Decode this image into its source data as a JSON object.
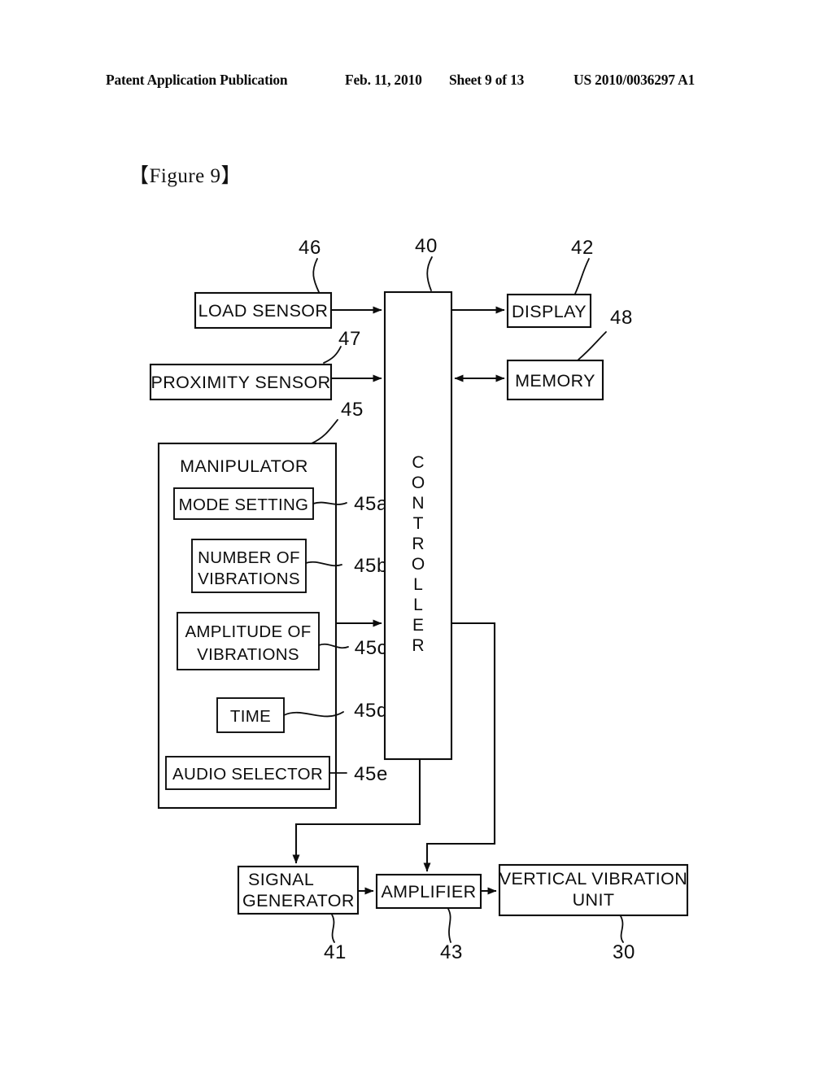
{
  "header": {
    "publication": "Patent Application Publication",
    "date": "Feb. 11, 2010",
    "sheet": "Sheet 9 of 13",
    "patent_number": "US 2010/0036297 A1"
  },
  "figure": {
    "label": "【Figure 9】"
  },
  "diagram": {
    "blocks": {
      "load_sensor": "LOAD SENSOR",
      "proximity_sensor": "PROXIMITY SENSOR",
      "manipulator": "MANIPULATOR",
      "mode_setting": "MODE SETTING",
      "number_of_vibrations_l1": "NUMBER OF",
      "number_of_vibrations_l2": "VIBRATIONS",
      "amplitude_of_vibrations_l1": "AMPLITUDE OF",
      "amplitude_of_vibrations_l2": "VIBRATIONS",
      "time": "TIME",
      "audio_selector": "AUDIO SELECTOR",
      "controller": "CONTROLLER",
      "display": "DISPLAY",
      "memory": "MEMORY",
      "signal_generator_l1": "SIGNAL",
      "signal_generator_l2": "GENERATOR",
      "amplifier": "AMPLIFIER",
      "vertical_vibration_unit_l1": "VERTICAL VIBRATION",
      "vertical_vibration_unit_l2": "UNIT"
    },
    "reference_numerals": {
      "load_sensor": "46",
      "controller": "40",
      "display": "42",
      "memory": "48",
      "proximity_sensor": "47",
      "manipulator": "45",
      "mode_setting": "45a",
      "number_of_vibrations": "45b",
      "amplitude_of_vibrations": "45c",
      "time": "45d",
      "audio_selector": "45e",
      "signal_generator": "41",
      "amplifier": "43",
      "vertical_vibration_unit": "30"
    },
    "controller_letters": [
      "C",
      "O",
      "N",
      "T",
      "R",
      "O",
      "L",
      "L",
      "E",
      "R"
    ],
    "ink_color": "#0d0d0d",
    "background_color": "#ffffff"
  }
}
